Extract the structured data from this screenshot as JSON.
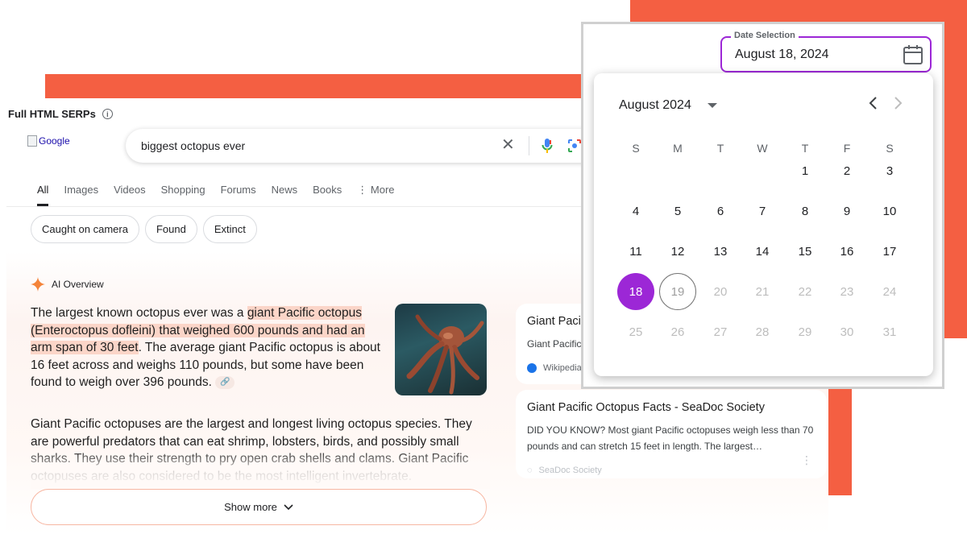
{
  "serp": {
    "title": "Full HTML SERPs",
    "info_icon": "info-icon",
    "logo_alt": "Google",
    "search": {
      "query": "biggest octopus ever",
      "clear_icon": "close-icon",
      "mic_icon": "mic-icon",
      "lens_icon": "lens-icon"
    },
    "tabs": [
      "All",
      "Images",
      "Videos",
      "Shopping",
      "Forums",
      "News",
      "Books",
      "⋮ More"
    ],
    "active_tab": "All",
    "chips": [
      "Caught on camera",
      "Found",
      "Extinct"
    ],
    "ai_overview": {
      "label": "AI Overview",
      "p1_a": "The largest known octopus ever was a ",
      "p1_hl": "giant Pacific octopus (Enteroctopus dofleini) that weighed 600 pounds and had an arm span of 30 feet",
      "p1_b": ". The average giant Pacific octopus is about 16 feet across and weighs 110 pounds, but some have been found to weigh over 396 pounds.",
      "p2_a": "Giant Pacific octopuses are the largest and longest living octopus species.",
      "p2_b": " They are powerful predators that can eat shrimp, lobsters, birds, and possibly small sharks. They use their strength to pry open crab shells and clams. Giant Pacific octopuses are also considered to be the most intelligent invertebrate.",
      "show_more": "Show more"
    },
    "cards": [
      {
        "title": "Giant Paci",
        "snippet": "Giant Pacific",
        "source": "Wikipedia"
      },
      {
        "title": "Giant Pacific Octopus Facts - SeaDoc Society",
        "snippet": "DID YOU KNOW? Most giant Pacific octopuses weigh less than 70 pounds and can stretch 15 feet in length. The largest…",
        "source": "SeaDoc Society"
      }
    ]
  },
  "date_picker": {
    "field_label": "Date Selection",
    "field_value": "August 18, 2024",
    "month_label": "August 2024",
    "weekdays": [
      "S",
      "M",
      "T",
      "W",
      "T",
      "F",
      "S"
    ],
    "weeks": [
      [
        "",
        "",
        "",
        "",
        "1",
        "2",
        "3"
      ],
      [
        "4",
        "5",
        "6",
        "7",
        "8",
        "9",
        "10"
      ],
      [
        "11",
        "12",
        "13",
        "14",
        "15",
        "16",
        "17"
      ],
      [
        "18",
        "19",
        "20",
        "21",
        "22",
        "23",
        "24"
      ],
      [
        "25",
        "26",
        "27",
        "28",
        "29",
        "30",
        "31"
      ]
    ],
    "selected_day": "18",
    "today_day": "19",
    "first_disabled_day": 19,
    "accent_color": "#9c27d6"
  },
  "colors": {
    "decor_orange": "#f45f42",
    "highlight": "#fbd5c8"
  }
}
